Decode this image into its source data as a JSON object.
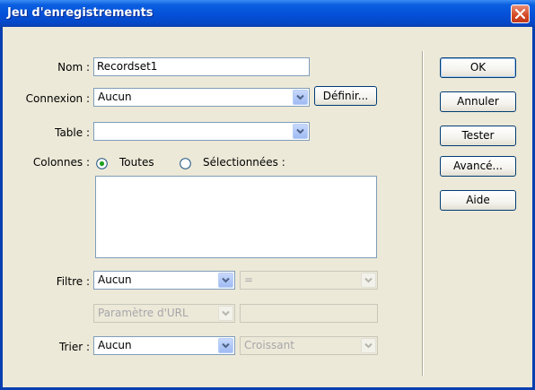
{
  "window": {
    "title": "Jeu d'enregistrements"
  },
  "form": {
    "nom": {
      "label": "Nom :",
      "value": "Recordset1"
    },
    "connexion": {
      "label": "Connexion :",
      "value": "Aucun",
      "button": "Définir..."
    },
    "table": {
      "label": "Table :",
      "value": ""
    },
    "colonnes": {
      "label": "Colonnes :",
      "option_all": "Toutes",
      "option_selected": "Sélectionnées :",
      "selected": "Toutes"
    },
    "filtre": {
      "label": "Filtre :",
      "column": "Aucun",
      "operator": "=",
      "source": "Paramètre d'URL",
      "value": ""
    },
    "trier": {
      "label": "Trier :",
      "column": "Aucun",
      "order": "Croissant"
    }
  },
  "buttons": {
    "ok": "OK",
    "annuler": "Annuler",
    "tester": "Tester",
    "avance": "Avancé...",
    "aide": "Aide"
  },
  "colors": {
    "titlebar": "#0550D8",
    "dialog_bg": "#ECE9D8",
    "field_border": "#7F9DB9",
    "close_button": "#D34824"
  }
}
